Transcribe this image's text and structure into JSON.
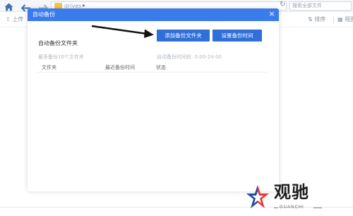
{
  "explorer": {
    "path_label": "drives",
    "search_placeholder": "搜索全部文件",
    "upload_label": "上传",
    "sort_label": "排序",
    "view_label": "视图"
  },
  "dialog": {
    "title": "自动备份",
    "section_label": "自动备份文件夹",
    "add_folder_button": "添加备份文件夹",
    "set_time_button": "设置备份时间",
    "limit_hint": "最多备份10个文件夹",
    "time_hint": "自动备份时间段:  0:00-24:00",
    "columns": [
      "文件夹",
      "最近备份时间",
      "状态"
    ]
  },
  "watermark": {
    "brand": "观驰",
    "brand_sub": "GUANCHI"
  },
  "colors": {
    "dialog_header": "#3b7cec",
    "primary_button": "#2e6fd8",
    "watermark_star_red": "#e53935",
    "watermark_star_blue": "#1e4fa6"
  }
}
